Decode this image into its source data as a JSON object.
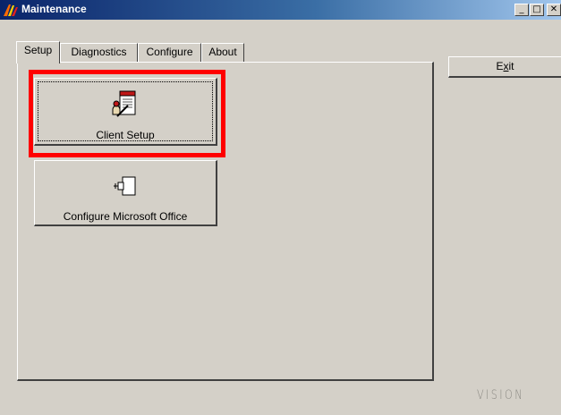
{
  "window": {
    "title": "Maintenance",
    "controls": {
      "minimize": "_",
      "maximize": "□",
      "close": "✕"
    }
  },
  "tabs": [
    {
      "label": "Setup",
      "active": true
    },
    {
      "label": "Diagnostics",
      "active": false
    },
    {
      "label": "Configure",
      "active": false
    },
    {
      "label": "About",
      "active": false
    }
  ],
  "setup_panel": {
    "buttons": [
      {
        "label": "Client Setup",
        "icon": "client-setup-icon",
        "highlighted": true
      },
      {
        "label": "Configure Microsoft Office",
        "icon": "office-plugin-icon",
        "highlighted": false
      }
    ]
  },
  "exit_button": {
    "label_prefix": "E",
    "label_underlined": "x",
    "label_suffix": "it"
  },
  "branding": {
    "text": "VISION"
  },
  "colors": {
    "highlight": "#ff0000",
    "titlebar": "#0a246a",
    "face": "#d4d0c8"
  }
}
